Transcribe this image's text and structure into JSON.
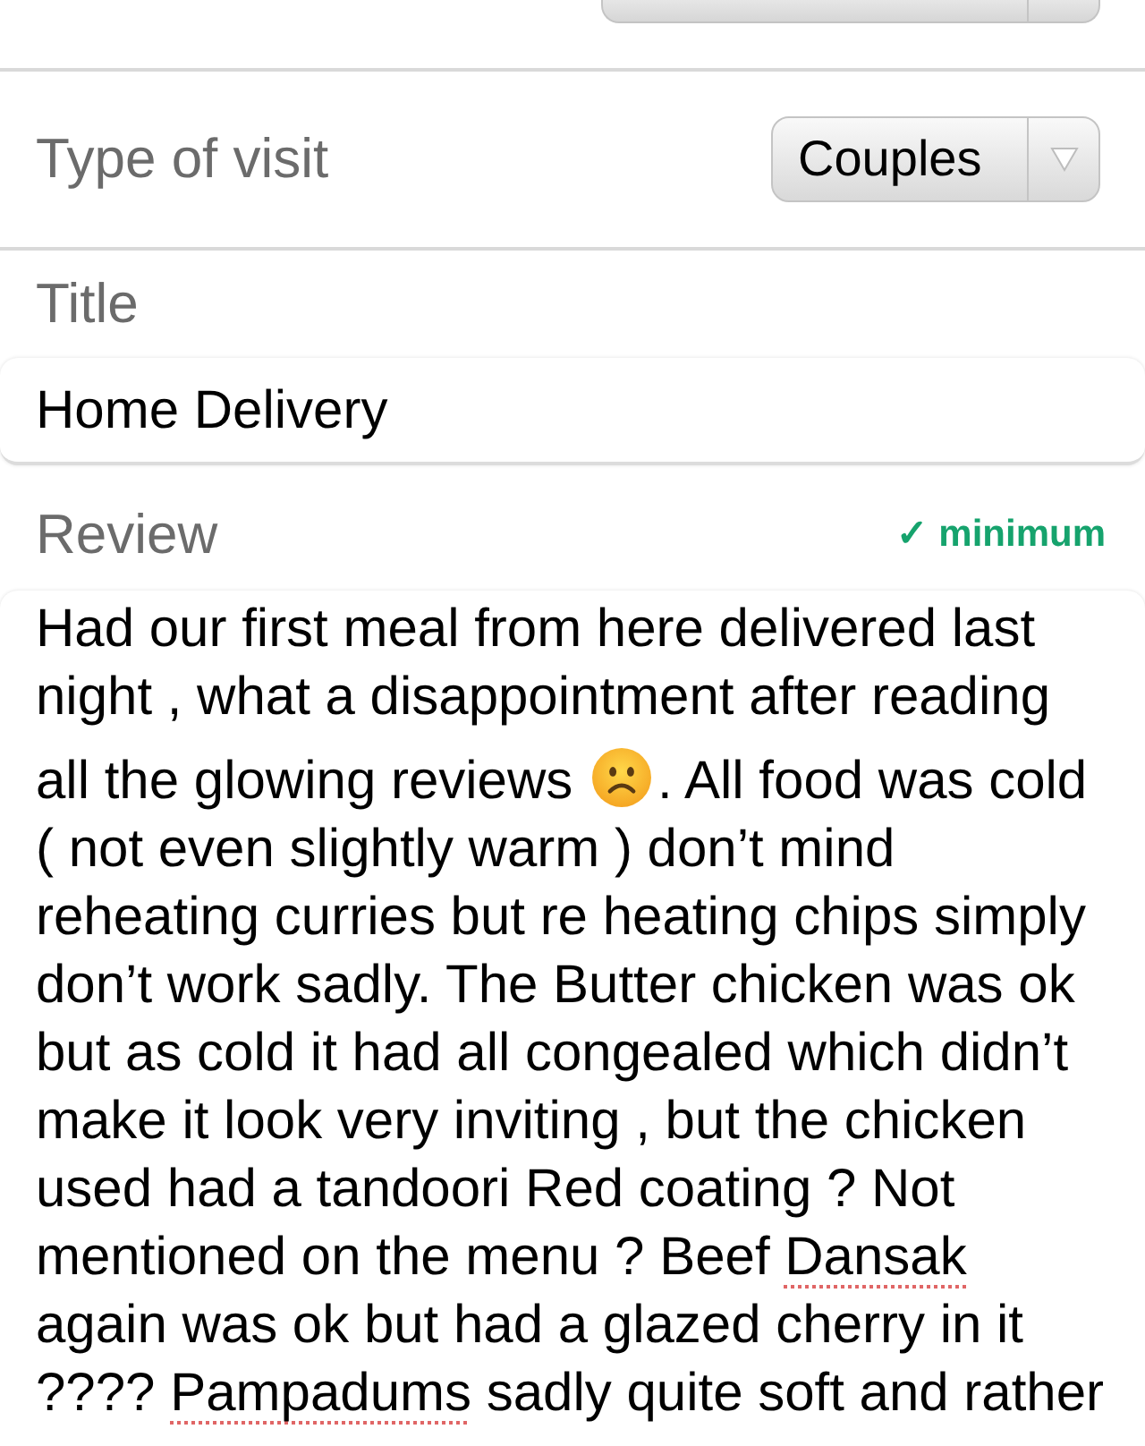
{
  "visit_type": {
    "label": "Type of visit",
    "value": "Couples"
  },
  "title": {
    "label": "Title",
    "value": "Home Delivery"
  },
  "review": {
    "label": "Review",
    "requirement": {
      "text": "✓ minimum",
      "met": true
    },
    "segments": [
      {
        "kind": "text",
        "text": "Had our first meal from here delivered last night , what a disappointment after reading all the glowing reviews "
      },
      {
        "kind": "emoji"
      },
      {
        "kind": "text",
        "text": ". All food was cold ( not even slightly warm ) don’t mind reheating curries but re heating chips simply don’t work sadly. The Butter chicken was ok but as cold it had all congealed which didn’t make it look very inviting , but the chicken used had a tandoori Red coating ? Not mentioned on the menu ? Beef "
      },
      {
        "kind": "misspelled",
        "text": "Dansak"
      },
      {
        "kind": "text",
        "text": " again was ok but had a glazed cherry in it ???? "
      },
      {
        "kind": "misspelled",
        "text": "Pampadums"
      },
      {
        "kind": "text",
        "text": " sadly quite soft and rather"
      }
    ]
  }
}
